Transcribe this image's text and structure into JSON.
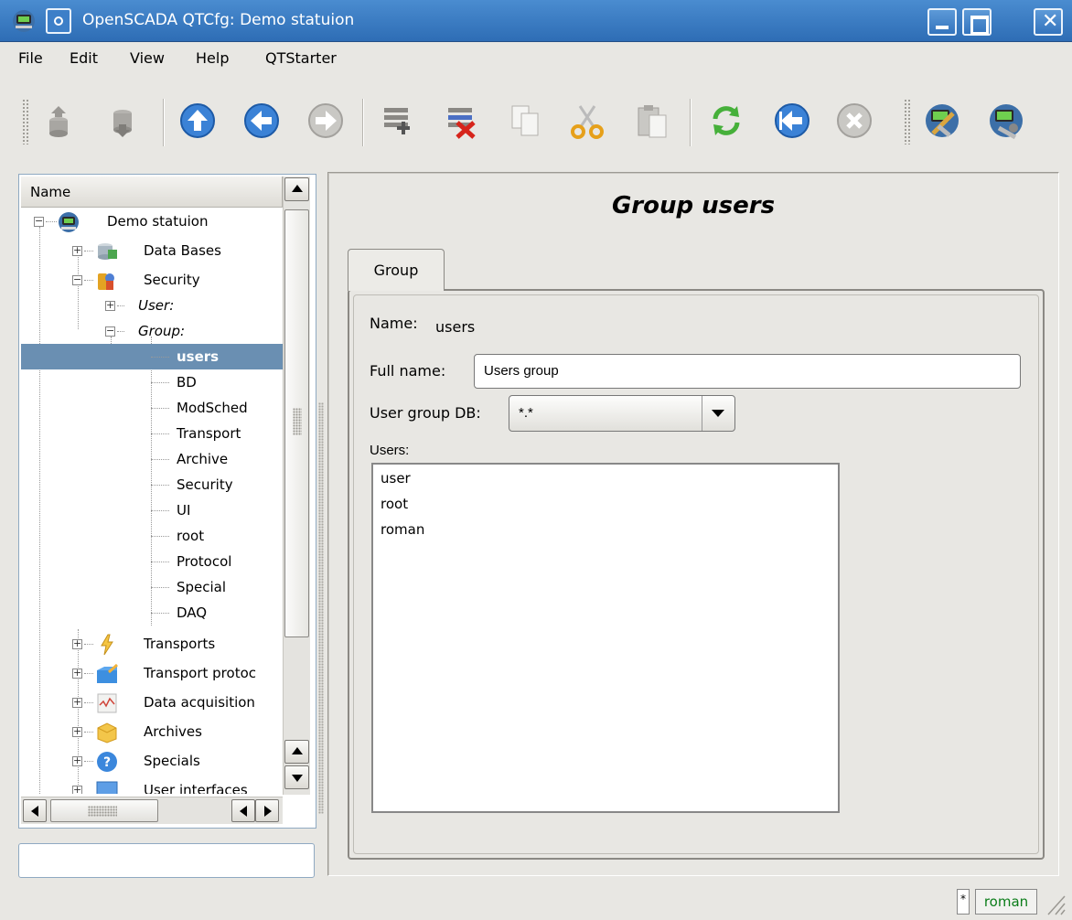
{
  "window": {
    "title": "OpenSCADA QTCfg: Demo statuion",
    "close_glyph": "✕"
  },
  "menu": [
    "File",
    "Edit",
    "View",
    "Help",
    "QTStarter"
  ],
  "toolbar": {
    "buttons": [
      "db-load-icon",
      "db-save-icon",
      "up-icon",
      "back-icon",
      "forward-icon",
      "add-item-icon",
      "delete-item-icon",
      "copy-icon",
      "cut-icon",
      "paste-icon",
      "refresh-icon",
      "start-icon",
      "stop-icon",
      "module-config-icon",
      "module-start-icon"
    ]
  },
  "tree": {
    "header": "Name",
    "items": [
      {
        "label": "Demo statuion",
        "icon": "station-icon",
        "expanded": true
      },
      {
        "label": "Data Bases",
        "icon": "databases-icon",
        "expanded": false
      },
      {
        "label": "Security",
        "icon": "security-icon",
        "expanded": true
      },
      {
        "label": "User:",
        "italic": true,
        "expanded": false
      },
      {
        "label": "Group:",
        "italic": true,
        "expanded": true
      },
      {
        "label": "users",
        "selected": true
      },
      {
        "label": "BD"
      },
      {
        "label": "ModSched"
      },
      {
        "label": "Transport"
      },
      {
        "label": "Archive"
      },
      {
        "label": "Security"
      },
      {
        "label": "UI"
      },
      {
        "label": "root"
      },
      {
        "label": "Protocol"
      },
      {
        "label": "Special"
      },
      {
        "label": "DAQ"
      },
      {
        "label": "Transports",
        "icon": "transports-icon",
        "expanded": false
      },
      {
        "label": "Transport protoc",
        "icon": "protocols-icon",
        "expanded": false
      },
      {
        "label": "Data acquisition",
        "icon": "daq-icon",
        "expanded": false
      },
      {
        "label": "Archives",
        "icon": "archives-icon",
        "expanded": false
      },
      {
        "label": "Specials",
        "icon": "specials-icon",
        "expanded": false
      },
      {
        "label": "User interfaces",
        "icon": "ui-icon",
        "expanded": false
      }
    ]
  },
  "page": {
    "title": "Group users",
    "tab": "Group",
    "name_label": "Name:",
    "name_value": "users",
    "fullname_label": "Full name:",
    "fullname_value": "Users group",
    "db_label": "User group DB:",
    "db_value": "*.*",
    "users_label": "Users:",
    "users": [
      "user",
      "root",
      "roman"
    ]
  },
  "status": {
    "modified": "*",
    "user": "roman"
  },
  "colors": {
    "title_bar": "#3a7cc4",
    "selection": "#6a8fb2",
    "status_user_text": "#0b7d1a"
  }
}
